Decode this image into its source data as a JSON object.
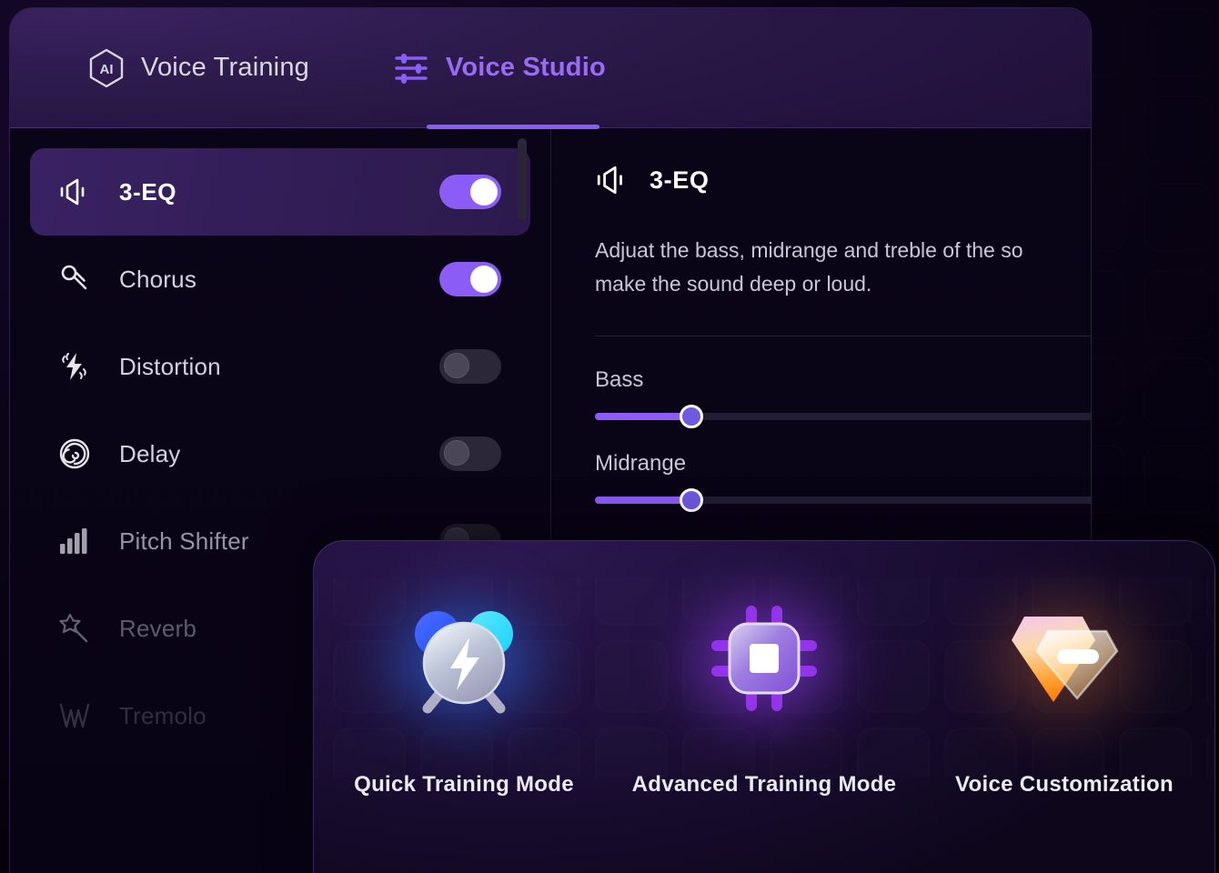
{
  "app": {
    "accent_purple": "#8b5cf6",
    "background": "#050210"
  },
  "header": {
    "tabs": [
      {
        "label": "Voice Training",
        "icon": "ai-hexagon-icon",
        "active": false
      },
      {
        "label": "Voice Studio",
        "icon": "sliders-icon",
        "active": true
      }
    ]
  },
  "effects_list": {
    "items": [
      {
        "label": "3-EQ",
        "icon": "speaker-icon",
        "toggle": "on",
        "selected": true,
        "fade": ""
      },
      {
        "label": "Chorus",
        "icon": "microphone-icon",
        "toggle": "on",
        "selected": false,
        "fade": ""
      },
      {
        "label": "Distortion",
        "icon": "distortion-icon",
        "toggle": "off",
        "selected": false,
        "fade": ""
      },
      {
        "label": "Delay",
        "icon": "spiral-icon",
        "toggle": "off",
        "selected": false,
        "fade": ""
      },
      {
        "label": "Pitch Shifter",
        "icon": "bars-icon",
        "toggle": "off",
        "selected": false,
        "fade": "fade-70"
      },
      {
        "label": "Reverb",
        "icon": "magic-wand-icon",
        "toggle": "off",
        "selected": false,
        "fade": "fade-45"
      },
      {
        "label": "Tremolo",
        "icon": "tremolo-wave-icon",
        "toggle": "off",
        "selected": false,
        "fade": "fade-22"
      }
    ],
    "scrollbar": "vertical-scrollbar"
  },
  "detail": {
    "icon": "speaker-icon",
    "title": "3-EQ",
    "description_line1": "Adjuat the bass, midrange and treble of the so",
    "description_line2": "make the sound deep or loud.",
    "sliders": [
      {
        "label": "Bass",
        "value_percent": 19
      },
      {
        "label": "Midrange",
        "value_percent": 19
      }
    ]
  },
  "modes": {
    "items": [
      {
        "label": "Quick Training Mode",
        "icon": "alarm-bolt-icon"
      },
      {
        "label": "Advanced Training Mode",
        "icon": "cpu-chip-icon"
      },
      {
        "label": "Voice Customization",
        "icon": "diamond-gem-icon"
      }
    ]
  }
}
